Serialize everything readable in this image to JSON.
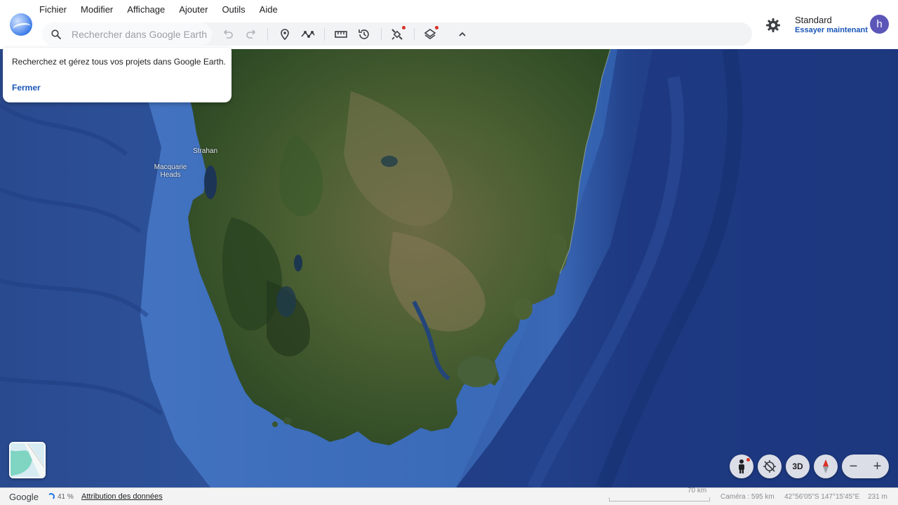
{
  "menu": {
    "items": [
      "Fichier",
      "Modifier",
      "Affichage",
      "Ajouter",
      "Outils",
      "Aide"
    ]
  },
  "search": {
    "placeholder": "Rechercher dans Google Earth"
  },
  "toolbar": {
    "buttons": [
      "undo-icon",
      "redo-icon",
      "placemark-icon",
      "path-icon",
      "ruler-icon",
      "history-icon",
      "satellite-icon",
      "layers-icon",
      "chevron-up-icon"
    ]
  },
  "account": {
    "plan": "Standard",
    "plan_link": "Essayer maintenant",
    "avatar_letter": "h"
  },
  "popup": {
    "message": "Recherchez et gérez tous vos projets dans Google Earth.",
    "close_label": "Fermer"
  },
  "map": {
    "labels": {
      "strahan": "Strahan",
      "macquarie_heads": "Macquarie Heads"
    }
  },
  "controls": {
    "three_d": "3D",
    "zoom_out": "−",
    "zoom_in": "+"
  },
  "status": {
    "brand": "Google",
    "loading": "41 %",
    "attribution": "Attribution des données",
    "scale": "70 km",
    "camera": "Caméra : 595 km",
    "coordinates": "42°56'05\"S 147°15'45\"E",
    "altitude": "231 m"
  },
  "colors": {
    "ocean": "#1c3a7a",
    "land": "#3f5a2c",
    "accent": "#1a56b8",
    "avatar": "#5c56b8",
    "notification": "#d93025"
  }
}
